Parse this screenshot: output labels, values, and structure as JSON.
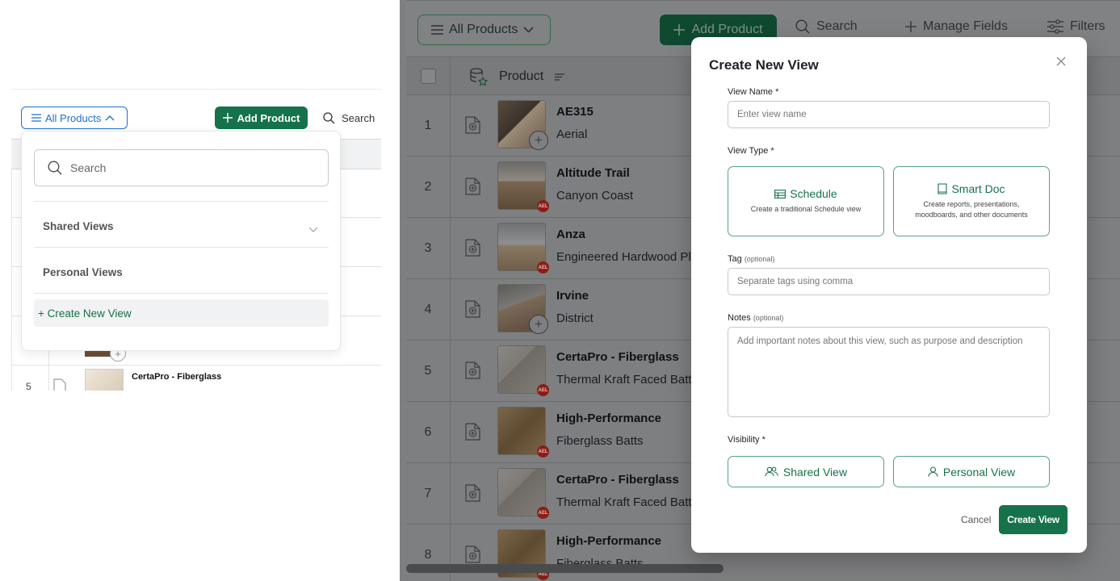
{
  "left": {
    "toolbar": {
      "all_products": "All Products",
      "add_product": "Add Product",
      "search": "Search"
    },
    "dropdown": {
      "search_placeholder": "Search",
      "shared_views": "Shared Views",
      "personal_views": "Personal Views",
      "create_new_view": "+ Create New View"
    },
    "partial_row": {
      "number": "5",
      "title": "CertaPro - Fiberglass"
    }
  },
  "right": {
    "toolbar": {
      "all_products": "All Products",
      "add_product": "Add Product",
      "search": "Search",
      "manage_fields": "Manage Fields",
      "filters": "Filters"
    },
    "table": {
      "product_header": "Product",
      "rows": [
        {
          "number": "1",
          "title": "AE315",
          "subtitle": "Aerial",
          "badge": "",
          "plus": true
        },
        {
          "number": "2",
          "title": "Altitude Trail",
          "subtitle": "Canyon Coast",
          "badge": "AEL",
          "plus": false
        },
        {
          "number": "3",
          "title": "Anza",
          "subtitle": "Engineered Hardwood Plank",
          "badge": "AEL",
          "plus": false
        },
        {
          "number": "4",
          "title": "Irvine",
          "subtitle": "District",
          "badge": "",
          "plus": true
        },
        {
          "number": "5",
          "title": "CertaPro - Fiberglass",
          "subtitle": "Thermal Kraft Faced Batts",
          "badge": "AEL",
          "plus": false
        },
        {
          "number": "6",
          "title": "High-Performance",
          "subtitle": "Fiberglass Batts",
          "badge": "AEL",
          "plus": false
        },
        {
          "number": "7",
          "title": "CertaPro - Fiberglass",
          "subtitle": "Thermal Kraft Faced Batts",
          "badge": "AEL",
          "plus": false
        },
        {
          "number": "8",
          "title": "High-Performance",
          "subtitle": "Fiberglass Batts",
          "badge": "AEL",
          "plus": false
        }
      ]
    }
  },
  "modal": {
    "title": "Create New View",
    "view_name_label": "View Name *",
    "view_name_placeholder": "Enter view name",
    "view_type_label": "View Type *",
    "schedule": {
      "title": "Schedule",
      "description": "Create a traditional Schedule view"
    },
    "smart_doc": {
      "title": "Smart Doc",
      "description_line1": "Create reports, presentations,",
      "description_line2": "moodboards, and other documents"
    },
    "tag_label": "Tag",
    "tag_optional": "(optional)",
    "tag_placeholder": "Separate tags using comma",
    "notes_label": "Notes",
    "notes_optional": "(optional)",
    "notes_placeholder": "Add important notes about this view, such as purpose and description",
    "visibility_label": "Visibility *",
    "shared_view": "Shared View",
    "personal_view": "Personal View",
    "cancel": "Cancel",
    "create_view": "Create View"
  },
  "colors": {
    "brand_green": "#15724a",
    "left_accent_blue": "#1f6fd1",
    "overlay_gray": "#7e7f80",
    "badge_red": "#8a1d18"
  },
  "icons": [
    "hamburger-icon",
    "chevron-up-icon",
    "chevron-down-icon",
    "plus-icon",
    "search-icon",
    "sliders-icon",
    "database-star-icon",
    "sort-icon",
    "add-file-icon",
    "close-icon",
    "table-icon",
    "document-icon",
    "users-icon",
    "user-icon"
  ]
}
